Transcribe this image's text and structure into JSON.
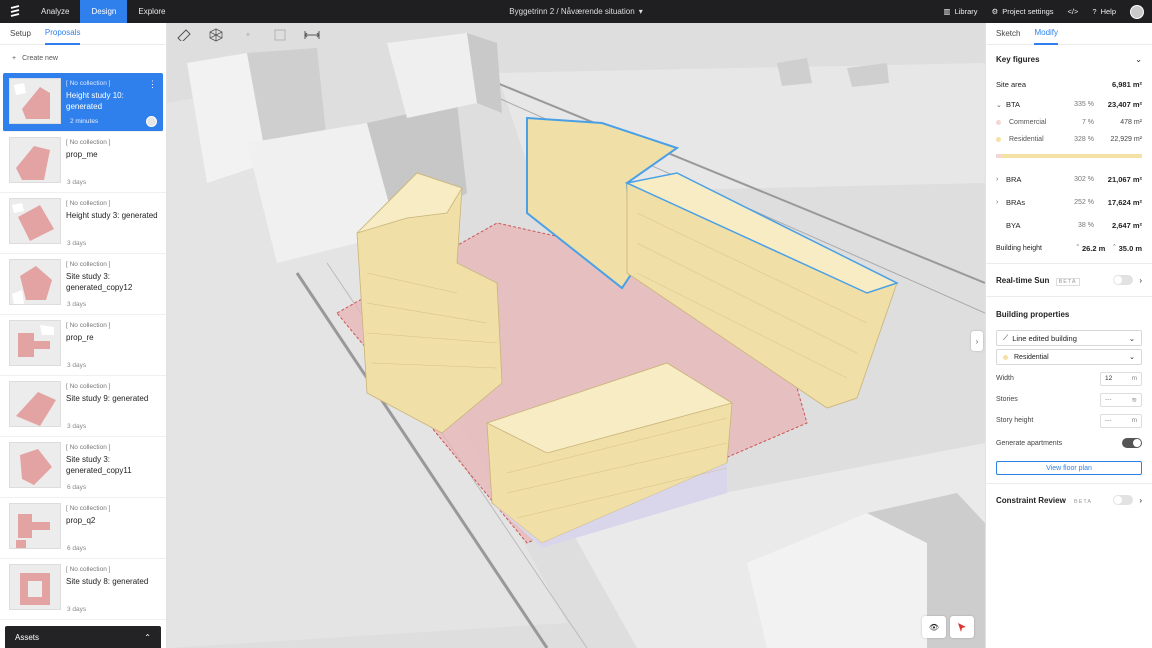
{
  "topbar": {
    "tabs": [
      "Analyze",
      "Design",
      "Explore"
    ],
    "breadcrumb": "Byggetrinn 2 / Nåværende situation",
    "right": {
      "library": "Library",
      "settings": "Project settings",
      "help": "Help"
    }
  },
  "left": {
    "tabs": [
      "Setup",
      "Proposals"
    ],
    "create": "Create new",
    "proposals": [
      {
        "tag": "[ No collection ]",
        "name": "Height study 10: generated",
        "time": "2 minutes"
      },
      {
        "tag": "[ No collection ]",
        "name": "prop_me",
        "time": "3 days"
      },
      {
        "tag": "[ No collection ]",
        "name": "Height study 3: generated",
        "time": "3 days"
      },
      {
        "tag": "[ No collection ]",
        "name": "Site study 3: generated_copy12",
        "time": "3 days"
      },
      {
        "tag": "[ No collection ]",
        "name": "prop_re",
        "time": "3 days"
      },
      {
        "tag": "[ No collection ]",
        "name": "Site study 9: generated",
        "time": "3 days"
      },
      {
        "tag": "[ No collection ]",
        "name": "Site study 3: generated_copy11",
        "time": "6 days"
      },
      {
        "tag": "[ No collection ]",
        "name": "prop_q2",
        "time": "6 days"
      },
      {
        "tag": "[ No collection ]",
        "name": "Site study 8: generated",
        "time": "3 days"
      }
    ],
    "assets": "Assets"
  },
  "right": {
    "tabs": [
      "Sketch",
      "Modify"
    ],
    "key_figures": {
      "title": "Key figures",
      "site_area": {
        "label": "Site area",
        "value": "6,981 m²"
      },
      "bta": {
        "label": "BTA",
        "pct": "335 %",
        "value": "23,407 m²"
      },
      "commercial": {
        "label": "Commercial",
        "pct": "7 %",
        "value": "478 m²"
      },
      "residential": {
        "label": "Residential",
        "pct": "328 %",
        "value": "22,929 m²"
      },
      "bra": {
        "label": "BRA",
        "pct": "302 %",
        "value": "21,067 m²"
      },
      "bras": {
        "label": "BRAs",
        "pct": "252 %",
        "value": "17,624 m²"
      },
      "bya": {
        "label": "BYA",
        "pct": "38 %",
        "value": "2,647 m²"
      },
      "building_height": {
        "label": "Building height",
        "min": "26.2 m",
        "max": "35.0 m"
      }
    },
    "realtime_sun": {
      "label": "Real-time Sun",
      "badge": "BETA"
    },
    "building_properties": {
      "title": "Building properties",
      "type": "Line edited building",
      "use": "Residential",
      "width": {
        "label": "Width",
        "value": "12",
        "unit": "m"
      },
      "stories": {
        "label": "Stories",
        "value": "---"
      },
      "story_height": {
        "label": "Story height",
        "value": "---",
        "unit": "m"
      },
      "generate": {
        "label": "Generate apartments"
      },
      "floor_plan": "View floor plan"
    },
    "constraint": {
      "label": "Constraint Review",
      "badge": "BETA"
    }
  },
  "colors": {
    "accent": "#2f80ed",
    "building": "#f0dfa6",
    "site": "#e8b5b5"
  }
}
